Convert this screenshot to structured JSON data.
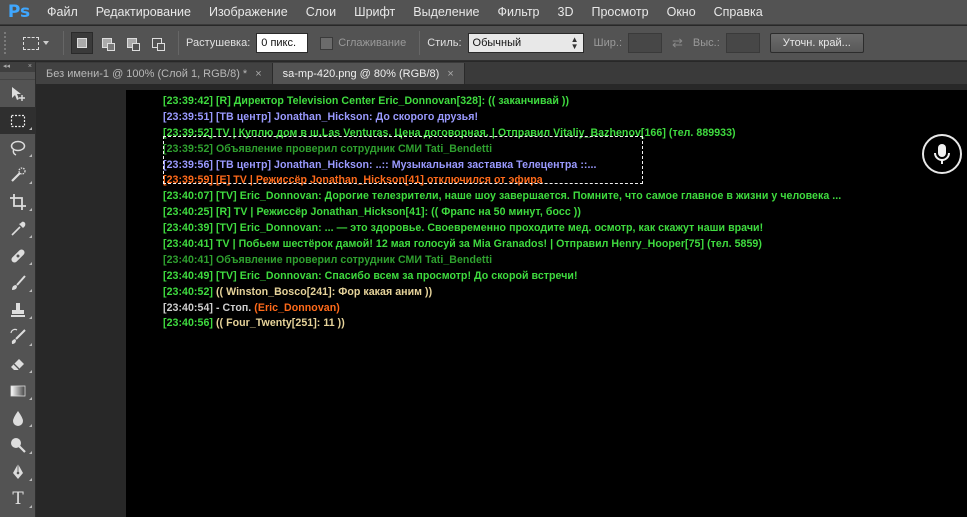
{
  "app": {
    "logo": "Ps"
  },
  "menu": [
    "Файл",
    "Редактирование",
    "Изображение",
    "Слои",
    "Шрифт",
    "Выделение",
    "Фильтр",
    "3D",
    "Просмотр",
    "Окно",
    "Справка"
  ],
  "options": {
    "feather_label": "Растушевка:",
    "feather_value": "0 пикс.",
    "antialias_label": "Сглаживание",
    "style_label": "Стиль:",
    "style_value": "Обычный",
    "width_label": "Шир.:",
    "height_label": "Выс.:",
    "refine_button": "Уточн. край..."
  },
  "tools_panel": {
    "collapse": "◂◂",
    "close": "×"
  },
  "tools": [
    "move-tool-icon",
    "rect-marquee-tool-icon",
    "lasso-tool-icon",
    "quick-select-tool-icon",
    "crop-tool-icon",
    "eyedropper-tool-icon",
    "healing-brush-tool-icon",
    "brush-tool-icon",
    "clone-stamp-tool-icon",
    "history-brush-tool-icon",
    "eraser-tool-icon",
    "gradient-tool-icon",
    "blur-tool-icon",
    "dodge-tool-icon",
    "pen-tool-icon",
    "type-tool-icon"
  ],
  "type_tool_glyph": "T",
  "tabs": [
    {
      "label": "Без имени-1 @ 100% (Слой 1, RGB/8) *",
      "close": "×",
      "active": false
    },
    {
      "label": "sa-mp-420.png @ 80% (RGB/8)",
      "close": "×",
      "active": true
    }
  ],
  "colors": {
    "green": "#3fdb3f",
    "blue": "#9a9aff",
    "orange": "#ff6a1a",
    "tan": "#e6d39a",
    "grey": "#cfcfcf",
    "dim_green": "#2fa12f"
  },
  "chat": [
    {
      "segments": [
        {
          "text": "[23:39:42] [R] Директор Television Center Eric_Donnovan[328]: (( заканчивай ))",
          "color": "#3fdb3f"
        }
      ]
    },
    {
      "segments": [
        {
          "text": "[23:39:51] [ТВ центр] Jonathan_Hickson: До скорого друзья!",
          "color": "#9a9aff"
        }
      ]
    },
    {
      "segments": [
        {
          "text": "[23:39:52] TV | Куплю дом в ш.Las Venturas. Цена договорная. | Отправил Vitaliy_Bazhenov[166] (тел. 889933)",
          "color": "#3fdb3f"
        }
      ]
    },
    {
      "segments": [
        {
          "text": "[23:39:52]",
          "color": "#2fa12f"
        },
        {
          "text": "   Объявление проверил сотрудник СМИ Tati_Bendetti",
          "color": "#2fa12f"
        }
      ]
    },
    {
      "segments": [
        {
          "text": "[23:39:56] [ТВ центр] Jonathan_Hickson: ..:: Музыкальная заставка Телецентра ::...",
          "color": "#9a9aff"
        }
      ]
    },
    {
      "segments": [
        {
          "text": "[23:39:59] [E] TV | Режиссёр Jonathan_Hickson[41] отключился от эфира",
          "color": "#ff6a1a"
        }
      ]
    },
    {
      "segments": [
        {
          "text": "[23:40:07] [TV] Eric_Donnovan: Дорогие телезрители, наше шоу завершается. Помните, что самое главное в жизни у человека ...",
          "color": "#3fdb3f"
        }
      ]
    },
    {
      "segments": [
        {
          "text": "[23:40:25] [R] TV | Режиссёр Jonathan_Hickson[41]: (( Фрапс на 50 минут, босс ))",
          "color": "#3fdb3f"
        }
      ]
    },
    {
      "segments": [
        {
          "text": "[23:40:39] [TV] Eric_Donnovan: ... — это здоровье. Своевременно проходите мед. осмотр, как скажут наши врачи!",
          "color": "#3fdb3f"
        }
      ]
    },
    {
      "segments": [
        {
          "text": "[23:40:41] TV | Побьем шестёрок дамой! 12 мая голосуй за Mia Granados! | Отправил Henry_Hooper[75] (тел. 5859)",
          "color": "#3fdb3f"
        }
      ]
    },
    {
      "segments": [
        {
          "text": "[23:40:41]",
          "color": "#2fa12f"
        },
        {
          "text": "   Объявление проверил сотрудник СМИ Tati_Bendetti",
          "color": "#2fa12f"
        }
      ]
    },
    {
      "segments": [
        {
          "text": "[23:40:49] [TV] Eric_Donnovan: Спасибо всем за просмотр! До скорой встречи!",
          "color": "#3fdb3f"
        }
      ]
    },
    {
      "segments": [
        {
          "text": "[23:40:52]",
          "color": "#3fdb3f"
        },
        {
          "text": " (( Winston_Bosco[241]: Фор какая аним ))",
          "color": "#e6d39a"
        }
      ]
    },
    {
      "segments": [
        {
          "text": "[23:40:54]",
          "color": "#cfcfcf"
        },
        {
          "text": " - Стоп. ",
          "color": "#cfcfcf"
        },
        {
          "text": "(Eric_Donnovan)",
          "color": "#ff6a1a"
        }
      ]
    },
    {
      "segments": [
        {
          "text": "[23:40:56]",
          "color": "#3fdb3f"
        },
        {
          "text": " (( Four_Twenty[251]: 11 ))",
          "color": "#e6d39a"
        }
      ]
    }
  ],
  "overlay": {
    "mic_button": "microphone-icon"
  }
}
